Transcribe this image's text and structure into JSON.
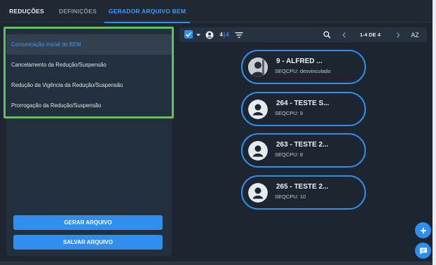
{
  "tabs": [
    {
      "label": "REDUÇÕES"
    },
    {
      "label": "DEFINIÇÕES"
    },
    {
      "label": "GERADOR ARQUIVO BEM"
    }
  ],
  "menu": {
    "items": [
      {
        "label": "Comunicação Inicial do BEM"
      },
      {
        "label": "Cancelamento da Redução/Suspensão"
      },
      {
        "label": "Redução da Vigência da Redução/Suspensão"
      },
      {
        "label": "Prorrogação da Redução/Suspensão"
      }
    ]
  },
  "buttons": {
    "generate": "GERAR ARQUIVO",
    "save": "SALVAR ARQUIVO"
  },
  "toolbar": {
    "selected_count": "4",
    "total_count": "4",
    "page_info": "1-4 DE 4",
    "sort_label": "AZ"
  },
  "cards": [
    {
      "title": "9 - ALFRED ...",
      "sub": "SEQCPU: desvinculado"
    },
    {
      "title": "264 - TESTE S...",
      "sub": "SEQCPU: 9"
    },
    {
      "title": "263 - TESTE 2...",
      "sub": "SEQCPU: 8"
    },
    {
      "title": "265 - TESTE 2...",
      "sub": "SEQCPU: 10"
    }
  ],
  "icons": {
    "checkbox": "checkbox-checked-icon",
    "caret": "caret-down-icon",
    "person": "person-icon",
    "filter": "filter-icon",
    "search": "search-icon",
    "prev": "chevron-left-icon",
    "next": "chevron-right-icon",
    "add": "plus-icon",
    "chat": "chat-icon"
  },
  "colors": {
    "accent": "#2f8fef",
    "highlight_outline": "#5cc45a",
    "background": "#1c2530",
    "panel": "#22303d"
  }
}
